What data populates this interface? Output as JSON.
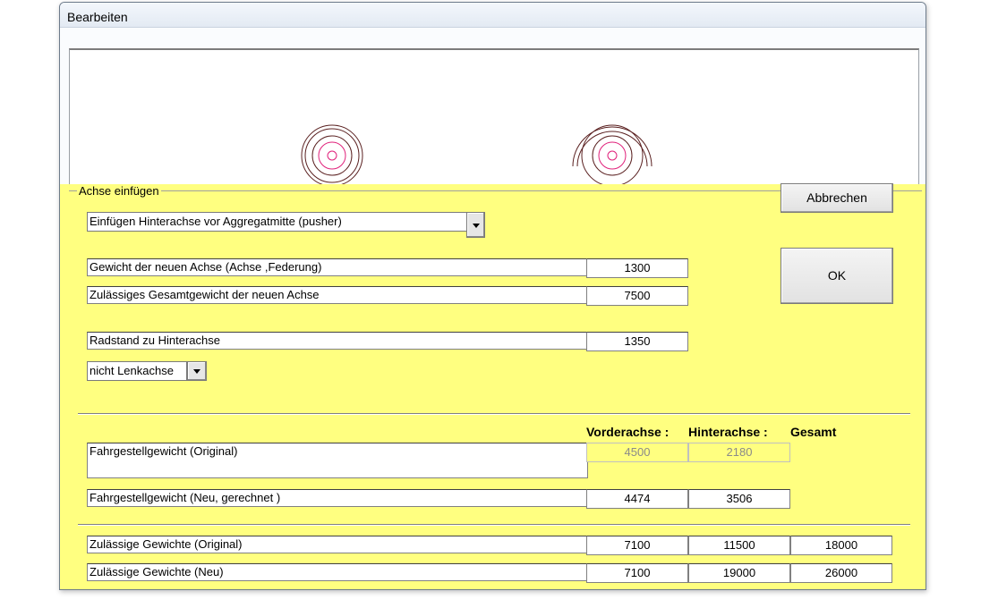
{
  "window": {
    "title": "Bearbeiten"
  },
  "group": {
    "label": "Achse einfügen"
  },
  "buttons": {
    "cancel": "Abbrechen",
    "ok": "OK"
  },
  "axle_type": {
    "selected": "Einfügen Hinterachse  vor Aggregatmitte (pusher)"
  },
  "fields": {
    "weight_new_axle": {
      "label": "Gewicht der neuen Achse (Achse ,Federung)",
      "value": "1300"
    },
    "permitted_total_new_axle": {
      "label": "Zulässiges Gesamtgewicht der neuen Achse",
      "value": "7500"
    },
    "wheelbase_rear": {
      "label": "Radstand zu Hinterachse",
      "value": "1350"
    }
  },
  "steering": {
    "selected": "nicht Lenkachse"
  },
  "table": {
    "headers": {
      "front": "Vorderachse :",
      "rear": "Hinterachse :",
      "total": "Gesamt"
    },
    "rows": [
      {
        "label": "Fahrgestellgewicht  (Original)",
        "front": "4500",
        "rear": "2180",
        "total": ""
      },
      {
        "label": "Fahrgestellgewicht  (Neu, gerechnet )",
        "front": "4474",
        "rear": "3506",
        "total": ""
      },
      {
        "label": "Zulässige Gewichte  (Original)",
        "front": "7100",
        "rear": "11500",
        "total": "18000"
      },
      {
        "label": "Zulässige Gewichte  (Neu)",
        "front": "7100",
        "rear": "19000",
        "total": "26000"
      }
    ]
  },
  "colors": {
    "panel": "#ffff80",
    "wheel_outer": "#5a2020",
    "wheel_inner": "#e0207a"
  }
}
